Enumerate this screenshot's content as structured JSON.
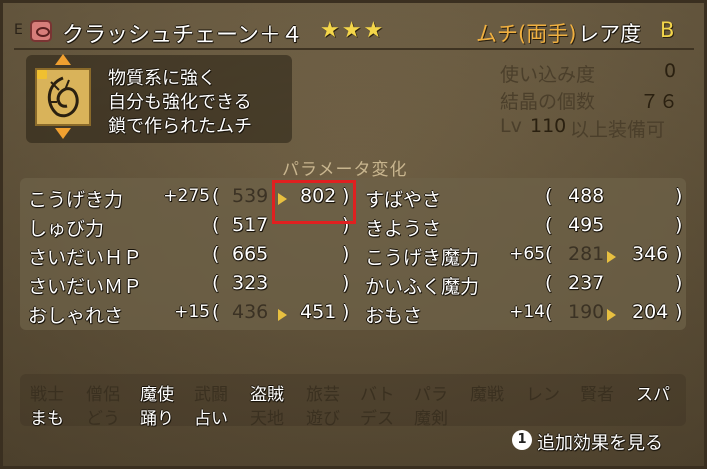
{
  "header": {
    "e_mark": "E",
    "item_name": "クラッシュチェーン＋４",
    "stars": "★★★",
    "weapon_type": "ムチ(両手)",
    "rarity_label": "レア度",
    "rarity_value": "B"
  },
  "item": {
    "icon": "chain-whip-icon",
    "description": [
      "物質系に強く",
      "自分も強化できる",
      "鎖で作られたムチ"
    ]
  },
  "info": {
    "usage_label": "使い込み度",
    "usage_value": "0",
    "crystal_label": "結晶の個数",
    "crystal_value": "７６",
    "level_label": "Lv",
    "level_value": "110",
    "level_suffix": "以上装備可"
  },
  "params": {
    "title": "パラメータ変化",
    "left": [
      {
        "label": "こうげき力",
        "bonus": "+275",
        "old": "539",
        "new": "802",
        "changed": true
      },
      {
        "label": "しゅび力",
        "bonus": "",
        "old": "517",
        "new": "",
        "changed": false
      },
      {
        "label": "さいだいＨＰ",
        "bonus": "",
        "old": "665",
        "new": "",
        "changed": false
      },
      {
        "label": "さいだいＭＰ",
        "bonus": "",
        "old": "323",
        "new": "",
        "changed": false
      },
      {
        "label": "おしゃれさ",
        "bonus": "+15",
        "old": "436",
        "new": "451",
        "changed": true
      }
    ],
    "right": [
      {
        "label": "すばやさ",
        "bonus": "",
        "old": "488",
        "new": "",
        "changed": false
      },
      {
        "label": "きようさ",
        "bonus": "",
        "old": "495",
        "new": "",
        "changed": false
      },
      {
        "label": "こうげき魔力",
        "bonus": "+65",
        "old": "281",
        "new": "346",
        "changed": true
      },
      {
        "label": "かいふく魔力",
        "bonus": "",
        "old": "237",
        "new": "",
        "changed": false
      },
      {
        "label": "おもさ",
        "bonus": "+14",
        "old": "190",
        "new": "204",
        "changed": true
      }
    ],
    "open_paren": "(",
    "close_paren": ")"
  },
  "jobs": {
    "row1": [
      {
        "name": "戦士",
        "on": false
      },
      {
        "name": "僧侶",
        "on": false
      },
      {
        "name": "魔使",
        "on": true
      },
      {
        "name": "武闘",
        "on": false
      },
      {
        "name": "盗賊",
        "on": true
      },
      {
        "name": "旅芸",
        "on": false
      },
      {
        "name": "バト",
        "on": false
      },
      {
        "name": "パラ",
        "on": false
      },
      {
        "name": "魔戦",
        "on": false
      },
      {
        "name": "レン",
        "on": false
      },
      {
        "name": "賢者",
        "on": false
      },
      {
        "name": "スパ",
        "on": true
      }
    ],
    "row2": [
      {
        "name": "まも",
        "on": true
      },
      {
        "name": "どう",
        "on": false
      },
      {
        "name": "踊り",
        "on": true
      },
      {
        "name": "占い",
        "on": true
      },
      {
        "name": "天地",
        "on": false
      },
      {
        "name": "遊び",
        "on": false
      },
      {
        "name": "デス",
        "on": false
      },
      {
        "name": "魔剣",
        "on": false
      }
    ]
  },
  "footer": {
    "button_glyph": "1",
    "button_label": "追加効果を見る"
  },
  "colors": {
    "highlight": "#e02020",
    "type_label": "#f0b040",
    "stars": "#f4d64a"
  }
}
